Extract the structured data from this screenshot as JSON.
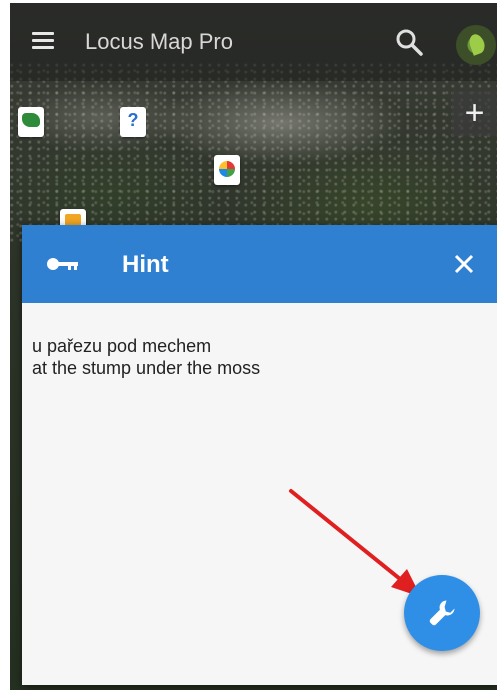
{
  "toolbar": {
    "app_title": "Locus Map Pro",
    "icons": {
      "menu": "menu-icon",
      "search": "search-icon",
      "gps": "gps-icon",
      "zoom_in": "plus-icon"
    },
    "zoom_in_label": "+"
  },
  "map": {
    "markers": [
      "leaf-marker-icon",
      "question-marker-icon",
      "multicolor-marker-icon",
      "yellow-marker-icon"
    ]
  },
  "dialog": {
    "title": "Hint",
    "header_icon": "key-icon",
    "close_icon": "close-icon",
    "hint_lines": [
      "u pařezu pod mechem",
      "at the stump under the moss"
    ],
    "fab_icon": "wrench-icon"
  },
  "colors": {
    "dialog_header": "#2f80d1",
    "fab": "#2f8fe6",
    "arrow": "#e02020",
    "dialog_body": "#f6f6f6"
  }
}
